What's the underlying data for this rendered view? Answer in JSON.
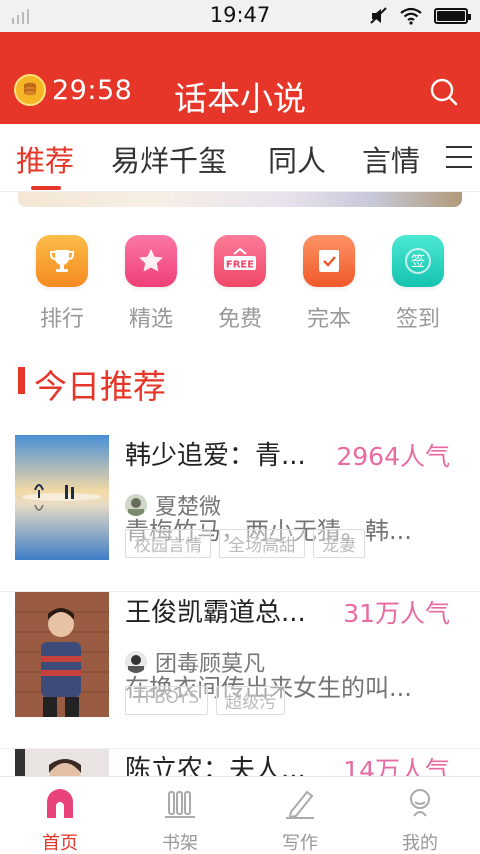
{
  "status_bar": {
    "time": "19:47"
  },
  "app_bar": {
    "timer": "29:58",
    "title": "话本小说"
  },
  "tabs": [
    {
      "label": "推荐",
      "active": true
    },
    {
      "label": "易烊千玺"
    },
    {
      "label": "同人"
    },
    {
      "label": "言情"
    }
  ],
  "quick_links": [
    {
      "label": "排行",
      "icon": "trophy-icon",
      "color": "#f8a12f"
    },
    {
      "label": "精选",
      "icon": "star-icon",
      "color": "#f2568c"
    },
    {
      "label": "免费",
      "icon": "free-icon",
      "color": "#f25e7c"
    },
    {
      "label": "完本",
      "icon": "check-note-icon",
      "color": "#f6703e"
    },
    {
      "label": "签到",
      "icon": "sign-in-icon",
      "color": "#27d7c4"
    }
  ],
  "section": {
    "title": "今日推荐"
  },
  "books": [
    {
      "title": "韩少追爱：青...",
      "popularity": "2964人气",
      "author": "夏楚微",
      "intro": "青梅竹马，两小无猜。韩...",
      "tags": [
        "校园言情",
        "全场高甜",
        "宠妻"
      ]
    },
    {
      "title": "王俊凯霸道总...",
      "popularity": "31万人气",
      "author": "团毒顾莫凡",
      "intro": "在换衣间传出来女生的叫...",
      "tags": [
        "TFBOYS",
        "超级污"
      ]
    },
    {
      "title": "陈立农：夫人...",
      "popularity": "14万人气",
      "author": "",
      "intro": "",
      "tags": []
    }
  ],
  "bottom_nav": [
    {
      "label": "首页",
      "active": true
    },
    {
      "label": "书架"
    },
    {
      "label": "写作"
    },
    {
      "label": "我的"
    }
  ],
  "colors": {
    "brand": "#e63529",
    "popularity": "#e86aa2"
  }
}
